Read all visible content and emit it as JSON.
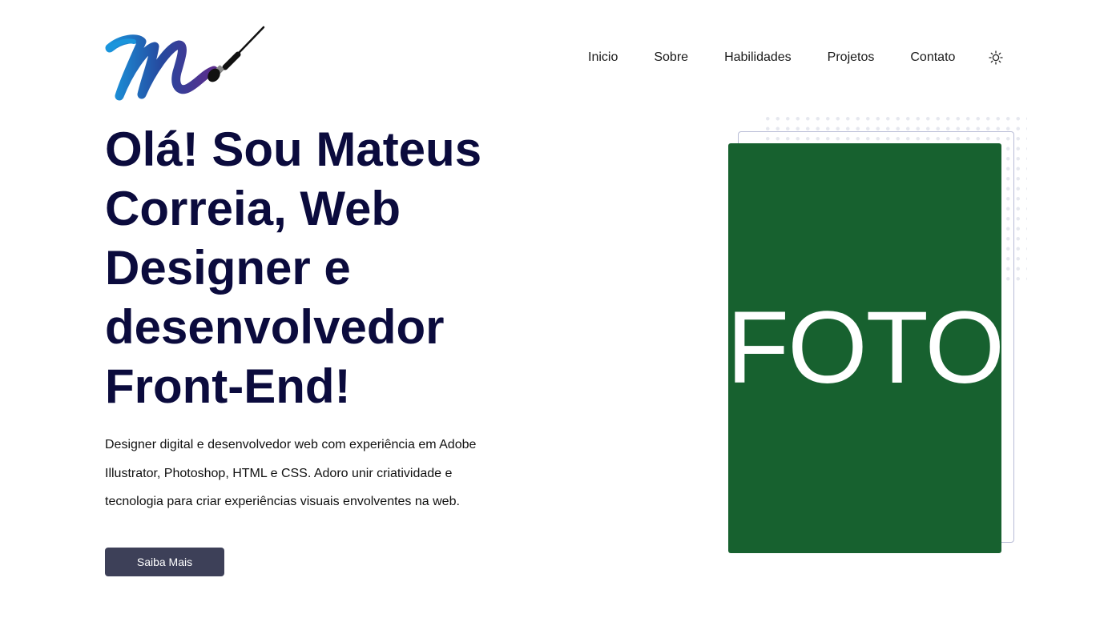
{
  "nav": {
    "items": [
      {
        "label": "Inicio"
      },
      {
        "label": "Sobre"
      },
      {
        "label": "Habilidades"
      },
      {
        "label": "Projetos"
      },
      {
        "label": "Contato"
      }
    ],
    "theme_icon": "sun-icon"
  },
  "logo": {
    "icon": "brush-m-logo",
    "colors": [
      "#1a8fd6",
      "#2a3f9e",
      "#5a2a8a"
    ]
  },
  "hero": {
    "title": "Olá! Sou Mateus Correia, Web Designer e desenvolvedor Front-End!",
    "description": "Designer digital e desenvolvedor web com experiência em Adobe Illustrator, Photoshop, HTML e CSS. Adoro unir criatividade e tecnologia para criar experiências visuais envolventes na web.",
    "cta_label": "Saiba Mais"
  },
  "photo": {
    "label": "FOTO",
    "color": "#17612f"
  },
  "colors": {
    "title": "#0b0b3d",
    "button": "#3d4058"
  }
}
